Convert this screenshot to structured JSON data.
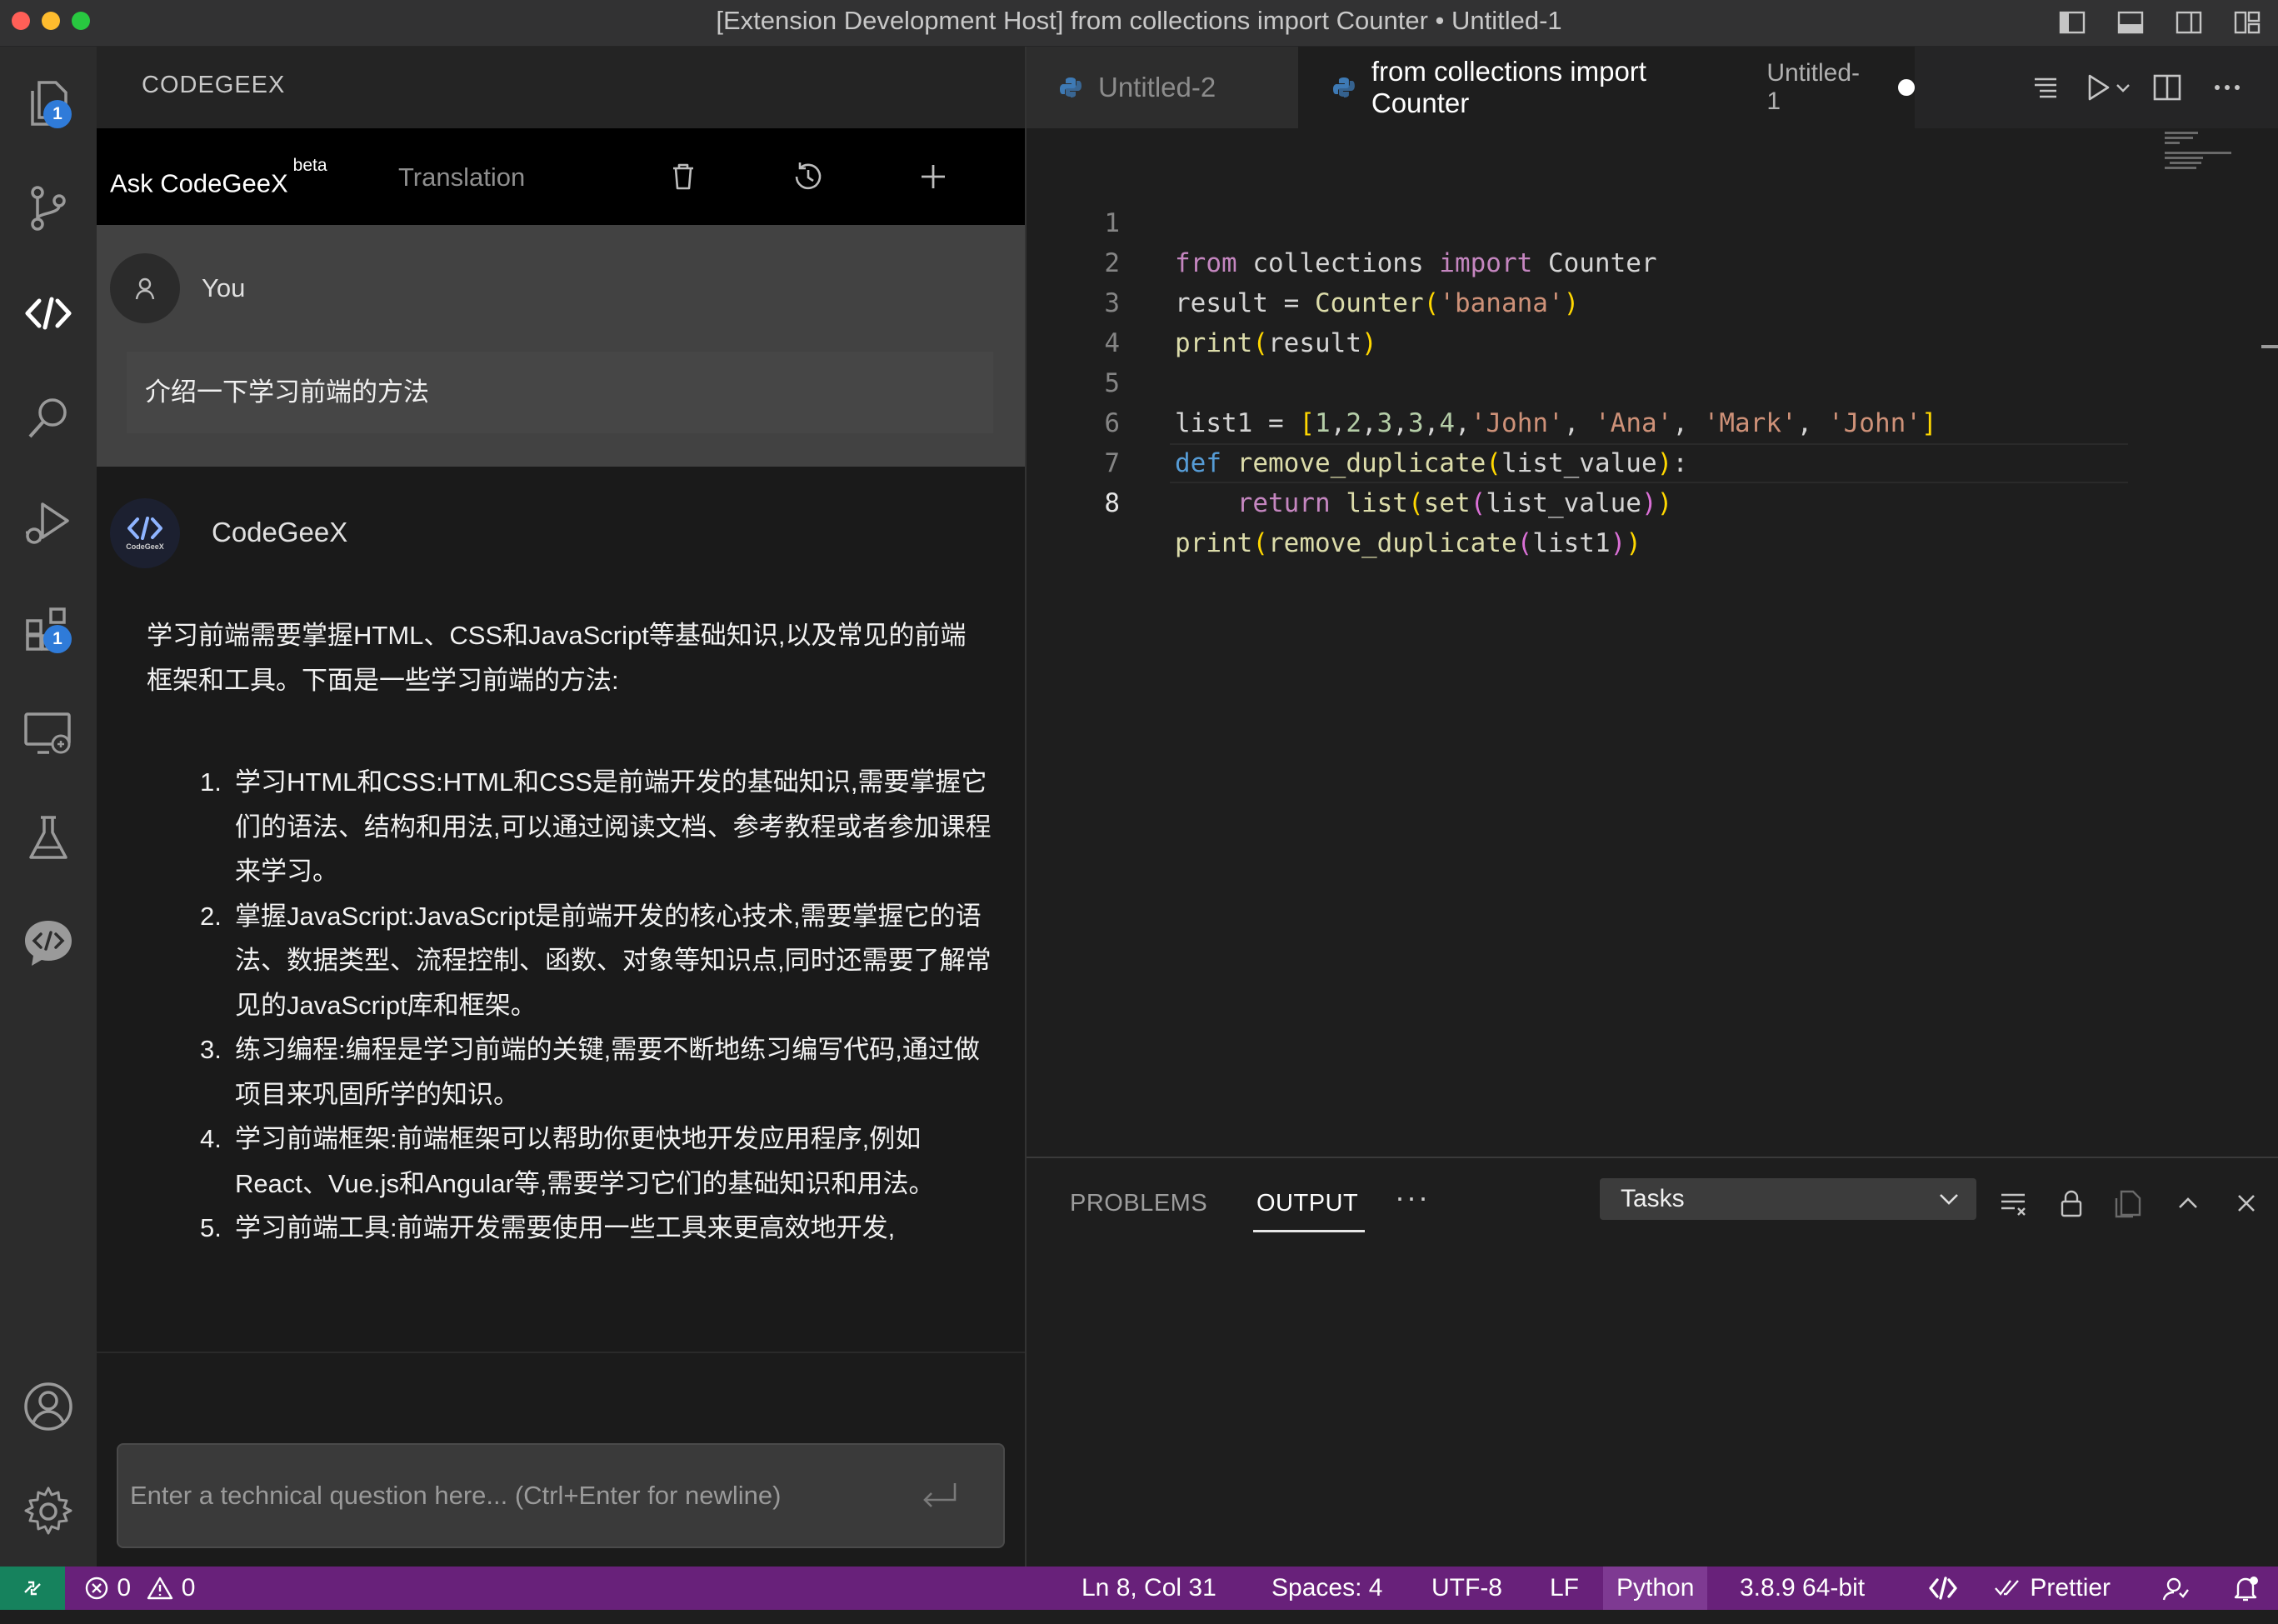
{
  "window": {
    "title": "[Extension Development Host] from collections import Counter • Untitled-1"
  },
  "activity_bar": {
    "explorer_badge": "1",
    "extensions_badge": "1"
  },
  "side_panel": {
    "header": "CODEGEEX",
    "tabs": {
      "ask": "Ask CodeGeeX",
      "ask_sup": "beta",
      "translation": "Translation"
    },
    "user": {
      "name": "You",
      "message": "介绍一下学习前端的方法"
    },
    "bot": {
      "name": "CodeGeeX",
      "avatar_label": "CodeGeeX",
      "intro": "学习前端需要掌握HTML、CSS和JavaScript等基础知识,以及常见的前端框架和工具。下面是一些学习前端的方法:",
      "items": [
        {
          "num": "1.",
          "text": "学习HTML和CSS:HTML和CSS是前端开发的基础知识,需要掌握它们的语法、结构和用法,可以通过阅读文档、参考教程或者参加课程来学习。"
        },
        {
          "num": "2.",
          "text": "掌握JavaScript:JavaScript是前端开发的核心技术,需要掌握它的语法、数据类型、流程控制、函数、对象等知识点,同时还需要了解常见的JavaScript库和框架。"
        },
        {
          "num": "3.",
          "text": "练习编程:编程是学习前端的关键,需要不断地练习编写代码,通过做项目来巩固所学的知识。"
        },
        {
          "num": "4.",
          "text": "学习前端框架:前端框架可以帮助你更快地开发应用程序,例如React、Vue.js和Angular等,需要学习它们的基础知识和用法。"
        },
        {
          "num": "5.",
          "text": "学习前端工具:前端开发需要使用一些工具来更高效地开发,"
        }
      ]
    },
    "input": {
      "placeholder": "Enter a technical question here... (Ctrl+Enter for newline)",
      "value": ""
    }
  },
  "editor": {
    "tabs": [
      {
        "label": "Untitled-2"
      },
      {
        "label": "from collections import Counter",
        "description": "Untitled-1",
        "dirty": true
      }
    ],
    "line_numbers": [
      "1",
      "2",
      "3",
      "4",
      "5",
      "6",
      "7",
      "8"
    ],
    "active_line": "8",
    "code_lines": [
      "from collections import Counter",
      "result = Counter('banana')",
      "print(result)",
      "",
      "list1 = [1,2,3,3,4,'John', 'Ana', 'Mark', 'John']",
      "def remove_duplicate(list_value):",
      "    return list(set(list_value))",
      "print(remove_duplicate(list1))"
    ]
  },
  "panel": {
    "tabs": {
      "problems": "PROBLEMS",
      "output": "OUTPUT",
      "more": "···"
    },
    "active_tab": "OUTPUT",
    "output_channel": "Tasks"
  },
  "status_bar": {
    "errors": "0",
    "warnings": "0",
    "cursor": "Ln 8, Col 31",
    "spaces": "Spaces: 4",
    "encoding": "UTF-8",
    "eol": "LF",
    "language": "Python",
    "interpreter": "3.8.9 64-bit",
    "formatter": "Prettier"
  },
  "colors": {
    "status_bar": "#68217a",
    "remote_indicator": "#16825d",
    "badge": "#2f7bd9",
    "keyword": "#569cd6",
    "string": "#ce9178",
    "function": "#dcdcaa"
  },
  "icons": {
    "activity": [
      "files-icon",
      "source-control-icon",
      "codegeex-icon",
      "search-icon",
      "run-debug-icon",
      "extensions-icon",
      "remote-explorer-icon",
      "testing-icon",
      "codegeex-chat-icon",
      "account-icon",
      "settings-gear-icon"
    ],
    "side_toolbar": [
      "trash-icon",
      "history-icon",
      "plus-icon"
    ],
    "editor_actions": [
      "outline-icon",
      "run-icon",
      "chevron-down-icon",
      "split-editor-icon",
      "more-icon"
    ],
    "panel_actions": [
      "clear-output-icon",
      "lock-icon",
      "open-log-icon",
      "maximize-icon",
      "close-icon"
    ]
  }
}
